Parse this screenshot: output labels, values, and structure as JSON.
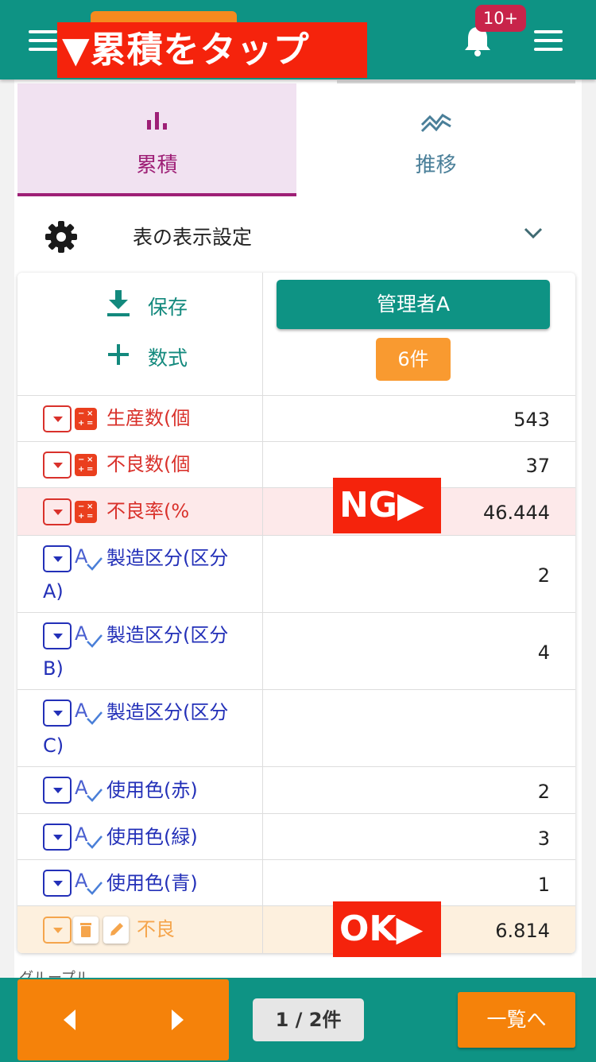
{
  "header": {
    "overlay_label": "▼累積をタップ",
    "notification_count": "10+"
  },
  "tabs": [
    {
      "label": "累積",
      "icon": "bar-chart-icon",
      "active": true
    },
    {
      "label": "推移",
      "icon": "trend-line-icon",
      "active": false
    }
  ],
  "settings": {
    "label": "表の表示設定"
  },
  "table_header": {
    "save_label": "保存",
    "formula_label": "数式",
    "manager_button": "管理者A",
    "count_badge": "6件"
  },
  "rows": [
    {
      "label": "生産数(個",
      "value": "543",
      "kind": "calc"
    },
    {
      "label": "不良数(個",
      "value": "37",
      "kind": "calc"
    },
    {
      "label": "不良率(%",
      "value": "46.444",
      "kind": "calc"
    },
    {
      "label": "製造区分(区分",
      "label2": "A)",
      "value": "2",
      "kind": "text"
    },
    {
      "label": "製造区分(区分",
      "label2": "B)",
      "value": "4",
      "kind": "text"
    },
    {
      "label": "製造区分(区分",
      "label2": "C)",
      "value": "",
      "kind": "text"
    },
    {
      "label": "使用色(赤)",
      "value": "2",
      "kind": "text"
    },
    {
      "label": "使用色(緑)",
      "value": "3",
      "kind": "text"
    },
    {
      "label": "使用色(青)",
      "value": "1",
      "kind": "text"
    },
    {
      "label": "不良",
      "value": "6.814",
      "kind": "custom"
    }
  ],
  "annotations": {
    "ng": "NG▶",
    "ok": "OK▶"
  },
  "group_peek": "グループル",
  "footer": {
    "page_count": "1 / 2件",
    "list_button": "一覧へ"
  },
  "colors": {
    "teal": "#0e9384",
    "orange": "#f5820a",
    "purple": "#9e1f76",
    "red": "#d9312b",
    "blue": "#2330b8",
    "annotation_red": "#f5230c"
  }
}
